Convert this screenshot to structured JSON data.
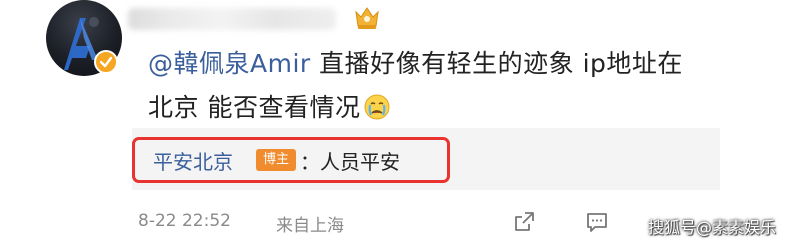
{
  "comment": {
    "mention": "@韓佩泉Amir",
    "line1_rest": " 直播好像有轻生的迹象 ip地址在",
    "line2": "北京 能否查看情况",
    "emoji": "crying-face-icon"
  },
  "reply": {
    "author": "平安北京",
    "tag": "博主",
    "text": "：人员平安"
  },
  "meta": {
    "time": "8-22 22:52",
    "location": "来自上海"
  },
  "watermark": "搜狐号@素素娱乐",
  "colors": {
    "mention": "#3a5f9c",
    "highlight": "#e8332e",
    "tag": "#f08c2e",
    "badge": "#f5a623"
  }
}
